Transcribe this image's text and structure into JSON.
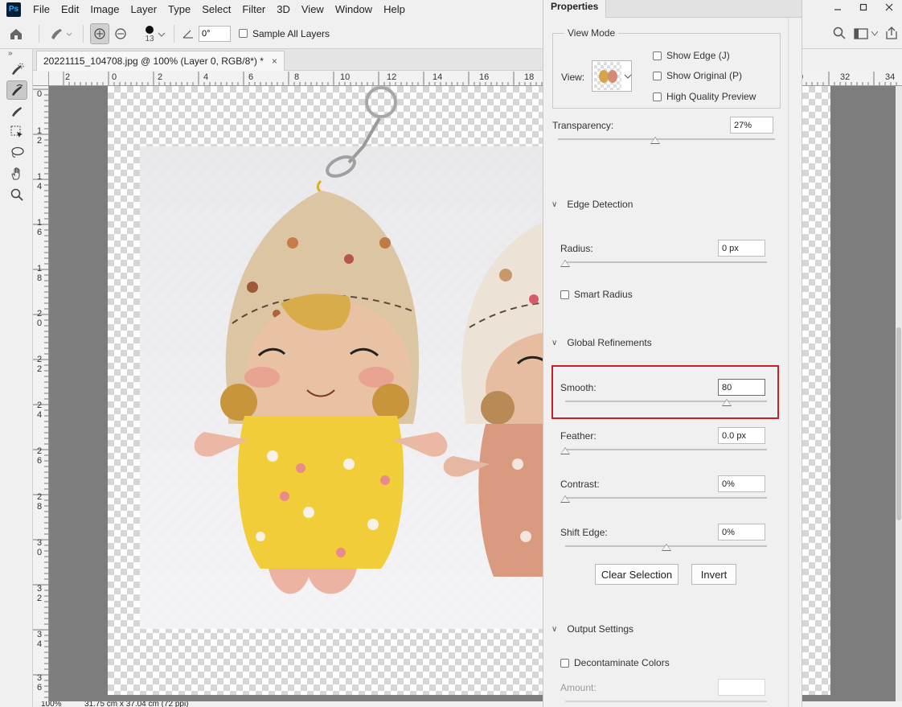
{
  "menu": {
    "logo": "Ps",
    "items": [
      "File",
      "Edit",
      "Image",
      "Layer",
      "Type",
      "Select",
      "Filter",
      "3D",
      "View",
      "Window",
      "Help"
    ]
  },
  "window_controls": [
    "minimize-icon",
    "restore-icon",
    "close-icon"
  ],
  "options_bar": {
    "brush_size": "13",
    "angle_value": "0°",
    "sample_all_layers_label": "Sample All Layers",
    "sample_all_layers_checked": false
  },
  "document": {
    "tab_title": "20221115_104708.jpg @ 100% (Layer 0, RGB/8*) *",
    "close_symbol": "×"
  },
  "rulers": {
    "horizontal_labels": [
      "2",
      "0",
      "2",
      "4",
      "6",
      "8",
      "10",
      "12",
      "14",
      "16",
      "18",
      "0",
      "32",
      "34"
    ],
    "vertical_labels": [
      "0",
      "1\n2",
      "1\n4",
      "1\n6",
      "1\n8",
      "2\n0",
      "2\n2",
      "2\n4",
      "2\n6",
      "2\n8",
      "3\n0",
      "3\n2",
      "3\n4",
      "3\n6"
    ]
  },
  "status": {
    "zoom": "100%",
    "doc_size": "31.75 cm x 37.04 cm (72 ppi)"
  },
  "properties": {
    "tab": "Properties",
    "view_mode": {
      "title": "View Mode",
      "view_label": "View:",
      "show_edge_label": "Show Edge (J)",
      "show_original_label": "Show Original (P)",
      "high_quality_label": "High Quality Preview",
      "show_edge_checked": false,
      "show_original_checked": false,
      "high_quality_checked": false
    },
    "transparency": {
      "label": "Transparency:",
      "value": "27%",
      "level": 0.27
    },
    "edge_detection": {
      "title": "Edge Detection",
      "radius_label": "Radius:",
      "radius_value": "0 px",
      "radius_level": 0,
      "smart_radius_label": "Smart Radius",
      "smart_radius_checked": false
    },
    "global_refinements": {
      "title": "Global Refinements",
      "smooth_label": "Smooth:",
      "smooth_value": "80",
      "smooth_level": 0.8,
      "feather_label": "Feather:",
      "feather_value": "0.0 px",
      "feather_level": 0,
      "contrast_label": "Contrast:",
      "contrast_value": "0%",
      "contrast_level": 0,
      "shift_edge_label": "Shift Edge:",
      "shift_edge_value": "0%",
      "shift_edge_level": 0.5,
      "clear_selection_label": "Clear Selection",
      "invert_label": "Invert"
    },
    "output_settings": {
      "title": "Output Settings",
      "decontaminate_label": "Decontaminate Colors",
      "decontaminate_checked": false,
      "amount_label": "Amount:",
      "amount_value": ""
    }
  },
  "colors": {
    "accent_focus": "#3478c8",
    "highlight_box": "#c8202a",
    "canvas_bg": "#7d7d7d"
  }
}
